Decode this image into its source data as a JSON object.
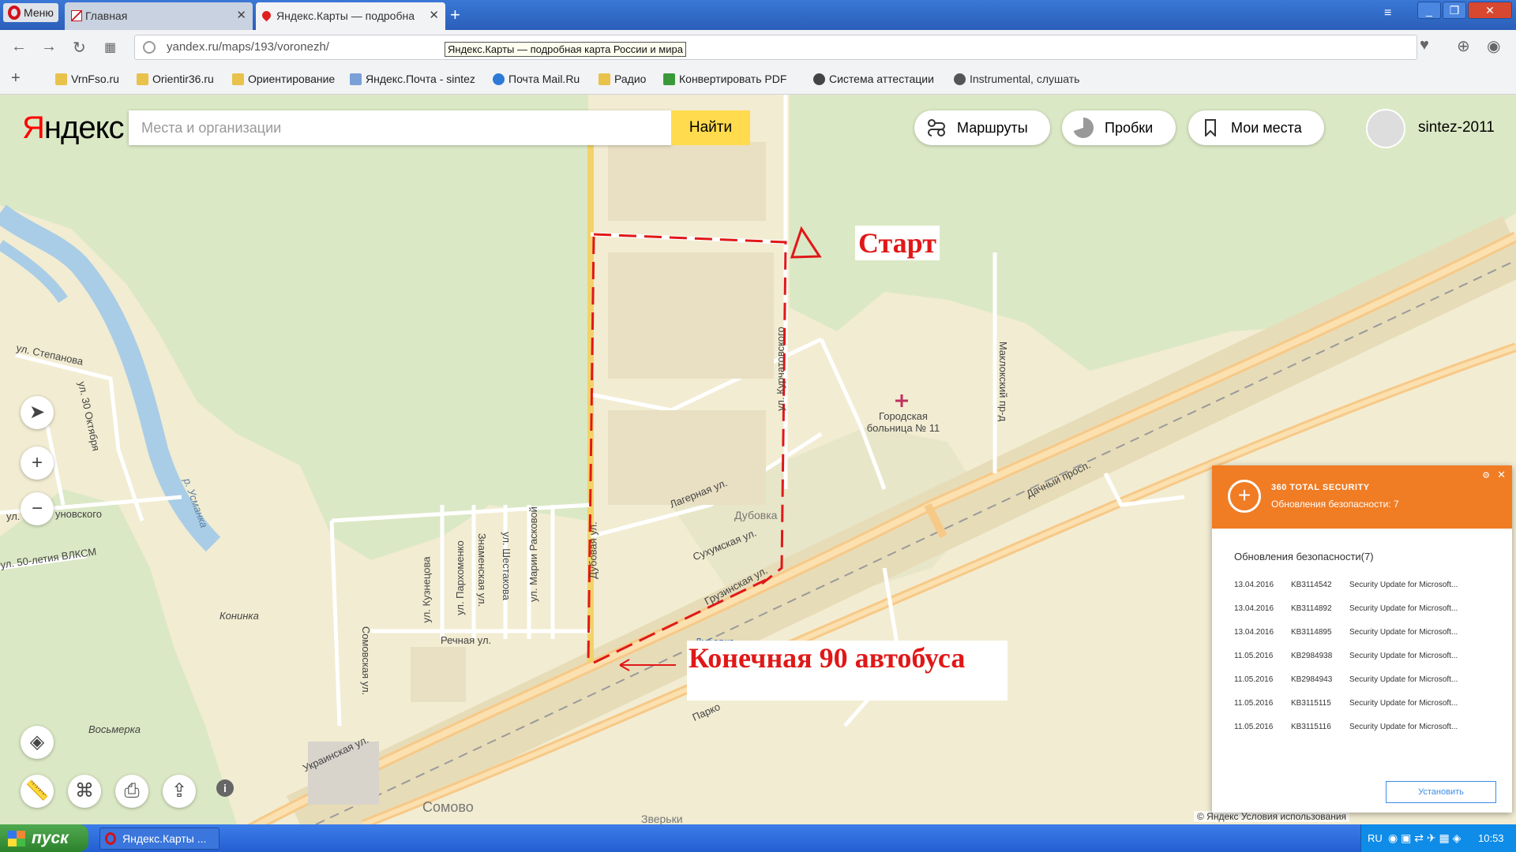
{
  "browser": {
    "menu_label": "Меню",
    "tabs": [
      {
        "title": "Главная",
        "active": false
      },
      {
        "title": "Яндекс.Карты — подробна",
        "active": true
      }
    ],
    "url": "yandex.ru/maps/193/voronezh/",
    "tooltip": "Яндекс.Карты — подробная карта России и мира",
    "bookmarks": [
      "VrnFso.ru",
      "Orientir36.ru",
      "Ориентирование",
      "Яндекс.Почта - sintez",
      "Почта Mail.Ru",
      "Радио",
      "Конвертировать PDF",
      "Система аттестации",
      "Instrumental, слушать"
    ]
  },
  "yandex": {
    "logo_red": "Я",
    "logo_black": "ндекс",
    "search_placeholder": "Места и организации",
    "find_label": "Найти",
    "routes_label": "Маршруты",
    "traffic_label": "Пробки",
    "my_places_label": "Мои места",
    "username": "sintez-2011",
    "copyright": "© Яндекс Условия использования"
  },
  "map": {
    "streets": [
      "ул. Степанова",
      "ул. 30 Октября",
      "Дубовая ул.",
      "ул. Курчатовского",
      "Маклокский пр-д",
      "Лагерная ул.",
      "Сухумская ул.",
      "Грузинская ул.",
      "Дачный просп.",
      "Речная ул.",
      "ул. Кузнецова",
      "ул. Пархоменко",
      "Знаменская ул.",
      "ул. Шестакова",
      "ул. Марии Расковой",
      "Сомовская ул.",
      "Украинская ул.",
      "ул. 50-летия ВЛКСМ",
      "ул.",
      "уновского",
      "р. Усманка",
      "Парко"
    ],
    "places": [
      "Городская больница № 11",
      "Дубовка",
      "Конинка",
      "Восьмерка",
      "Сомово",
      "Зверьки",
      "Дубовка"
    ],
    "annotations": {
      "start": "Старт",
      "finish": "Конечная 90 автобуса"
    }
  },
  "popup": {
    "brand": "360 TOTAL SECURITY",
    "subtitle": "Обновления безопасности: 7",
    "heading": "Обновления безопасности(7)",
    "updates": [
      {
        "date": "13.04.2016",
        "kb": "KB3114542",
        "name": "Security Update for Microsoft..."
      },
      {
        "date": "13.04.2016",
        "kb": "KB3114892",
        "name": "Security Update for Microsoft..."
      },
      {
        "date": "13.04.2016",
        "kb": "KB3114895",
        "name": "Security Update for Microsoft..."
      },
      {
        "date": "11.05.2016",
        "kb": "KB2984938",
        "name": "Security Update for Microsoft..."
      },
      {
        "date": "11.05.2016",
        "kb": "KB2984943",
        "name": "Security Update for Microsoft..."
      },
      {
        "date": "11.05.2016",
        "kb": "KB3115115",
        "name": "Security Update for Microsoft..."
      },
      {
        "date": "11.05.2016",
        "kb": "KB3115116",
        "name": "Security Update for Microsoft..."
      }
    ],
    "install_label": "Установить"
  },
  "taskbar": {
    "start_label": "пуск",
    "task_label": "Яндекс.Карты ...",
    "lang": "RU",
    "clock": "10:53"
  },
  "colors": {
    "yandex_red": "#ff0000",
    "find_yellow": "#ffdb4d",
    "popup_orange": "#f07c24",
    "annotation_red": "#e01818"
  }
}
